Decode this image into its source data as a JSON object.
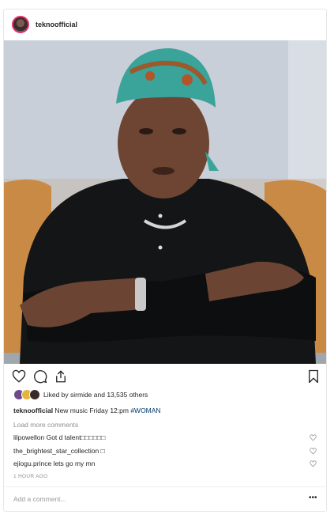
{
  "post": {
    "username": "teknoofficial",
    "likes_text": "Liked by sirmide and 13,535 others",
    "caption": {
      "username": "teknoofficial",
      "text": " New music Friday 12:pm ",
      "hashtag": "#WOMAN"
    },
    "load_more": "Load more comments",
    "comments": [
      {
        "user": "lilpowellon",
        "text": " Got d talent□□□□□□"
      },
      {
        "user": "the_brightest_star_collection",
        "text": " □"
      },
      {
        "user": "ejiogu.prince",
        "text": " lets go my mn"
      }
    ],
    "time": "1 HOUR AGO",
    "add_comment_placeholder": "Add a comment...",
    "more_label": "•••",
    "icons": {
      "like": "heart-icon",
      "comment": "comment-icon",
      "share": "share-icon",
      "save": "bookmark-icon",
      "comment_like": "heart-icon"
    }
  },
  "colors": {
    "avatar_ring": "#e1306c",
    "hashtag": "#00376b",
    "muted": "#8e8e8e"
  }
}
